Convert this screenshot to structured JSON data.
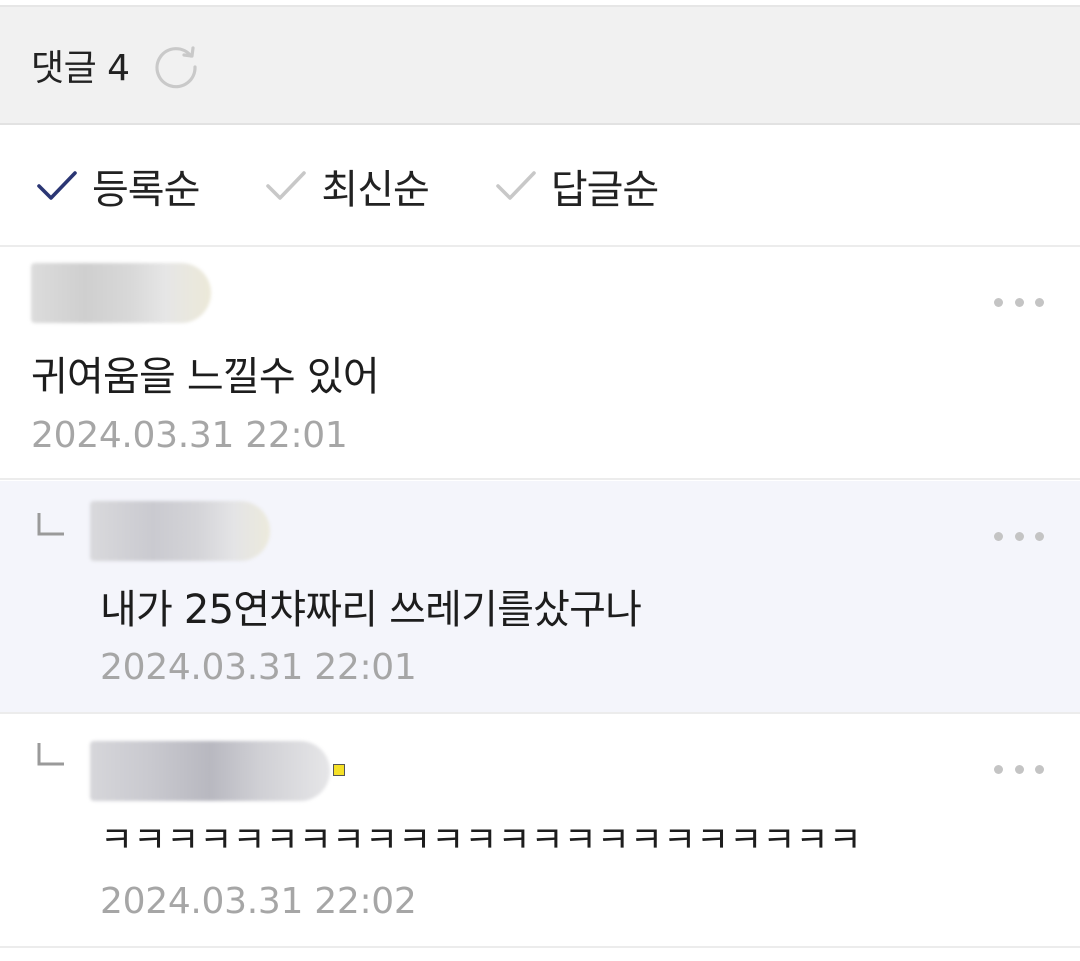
{
  "header": {
    "title": "댓글 4",
    "refresh_icon": "refresh-icon"
  },
  "sort": [
    {
      "label": "등록순",
      "active": true
    },
    {
      "label": "최신순",
      "active": false
    },
    {
      "label": "답글순",
      "active": false
    }
  ],
  "comments": [
    {
      "text": "귀여움을 느낄수 있어",
      "date": "2024.03.31 22:01",
      "is_reply": false
    },
    {
      "text": "내가 25연챠짜리 쓰레기를샀구나",
      "date": "2024.03.31 22:01",
      "is_reply": true
    },
    {
      "text": "ㅋㅋㅋㅋㅋㅋㅋㅋㅋㅋㅋㅋㅋㅋㅋㅋㅋㅋㅋㅋㅋㅋㅋ",
      "date": "2024.03.31 22:02",
      "is_reply": true
    }
  ],
  "colors": {
    "accent_check": "#2b3674",
    "inactive_check": "#c8c8c8",
    "reply_bg": "#f4f5fb",
    "date": "#a6a6a6"
  }
}
